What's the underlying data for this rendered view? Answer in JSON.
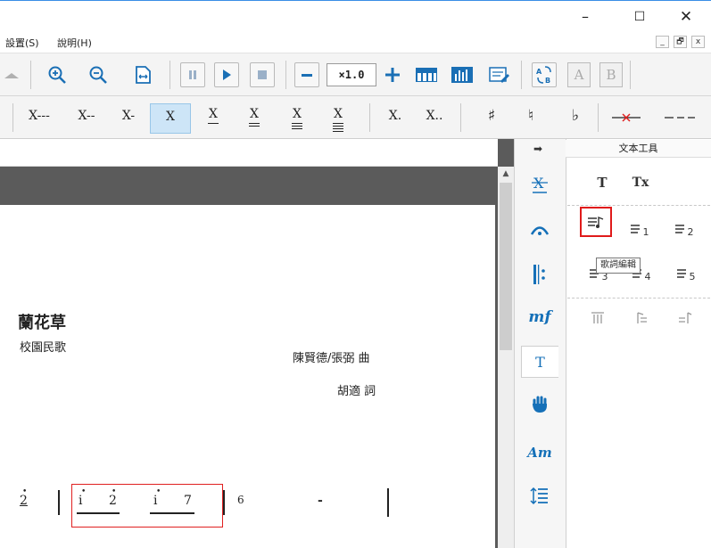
{
  "window": {
    "minimize": "–",
    "maximize": "☐",
    "close": "✕"
  },
  "menu": {
    "settings": "設置(S)",
    "help": "說明(H)"
  },
  "mdi": {
    "min": "_",
    "restore": "🗗",
    "close": "x"
  },
  "toolbar": {
    "zoom_value": "×1.0",
    "letter_a": "A",
    "letter_b": "B"
  },
  "durations": [
    "X---",
    "X--",
    "X-",
    "X",
    "X",
    "X",
    "X",
    "X",
    "X.",
    "X.."
  ],
  "accidentals": {
    "sharp": "♯",
    "natural": "♮",
    "flat": "♭"
  },
  "score": {
    "title": "蘭花草",
    "subtitle": "校園民歌",
    "composer": "陳賢德/張弼 曲",
    "lyricist": "胡適 詞",
    "notes": [
      "2",
      "i",
      "2",
      "i",
      "7",
      "6",
      "-"
    ]
  },
  "side_tabs": {
    "dynamic_label": "mf",
    "text_label": "T",
    "chord_label": "Am"
  },
  "text_panel": {
    "title": "文本工具",
    "text_tool": "T",
    "clear_tool": "Tx",
    "lyric_tooltip": "歌詞編輯",
    "verse_labels": [
      "1",
      "2",
      "3",
      "4",
      "5"
    ]
  }
}
